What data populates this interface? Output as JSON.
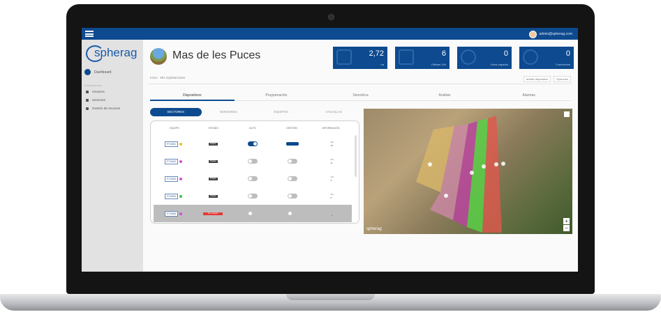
{
  "app": {
    "brand": "spherag",
    "user_email": "admin@spherag.com",
    "accent": "#0d4a8f"
  },
  "sidebar": {
    "home_label": "Dashboard",
    "group_label": "Explotaciones",
    "items": [
      {
        "label": "Usuarios",
        "icon": "user-icon"
      },
      {
        "label": "Sensores",
        "icon": "sensor-icon"
      },
      {
        "label": "Gestión de recursos",
        "icon": "gear-icon"
      }
    ]
  },
  "page": {
    "title": "Mas de les Puces",
    "breadcrumb": [
      "Inicio",
      "Mis explotaciones"
    ],
    "actions": [
      "Añadir dispositivo",
      "Opciones"
    ]
  },
  "stats": [
    {
      "value": "2,72",
      "label": "ha",
      "icon": "area-icon"
    },
    {
      "value": "6",
      "label": "Últimas 24h",
      "icon": "book-icon"
    },
    {
      "value": "0",
      "label": "Litros regados",
      "icon": "drop-icon"
    },
    {
      "value": "0",
      "label": "Conexiones",
      "icon": "signal-icon"
    }
  ],
  "tabs": [
    {
      "label": "Dispositivos",
      "active": true
    },
    {
      "label": "Programación",
      "active": false
    },
    {
      "label": "Sensórica",
      "active": false
    },
    {
      "label": "Análisis",
      "active": false
    },
    {
      "label": "Alarmas",
      "active": false
    }
  ],
  "subtabs": [
    {
      "label": "SECTORES",
      "active": true
    },
    {
      "label": "SENSORES",
      "active": false
    },
    {
      "label": "EQUIPOS",
      "active": false
    },
    {
      "label": "VÁLVULAS",
      "active": false
    }
  ],
  "table": {
    "columns": [
      "EQUIPO",
      "ESTADO",
      "AUTO",
      "GESTIÓN",
      "INFORMACIÓN"
    ],
    "rows": [
      {
        "device": "FT-0001",
        "dot": "#e6c21a",
        "state": "Parado",
        "auto": true,
        "manage": true,
        "info": [
          "4.6",
          "18"
        ],
        "selected": false
      },
      {
        "device": "FT-0002",
        "dot": "#d64fd6",
        "state": "Parado",
        "auto": false,
        "manage": false,
        "info": [
          "4.6",
          "11"
        ],
        "selected": false
      },
      {
        "device": "FT-0003",
        "dot": "#d64fd6",
        "state": "Parado",
        "auto": false,
        "manage": false,
        "info": [
          "4.6",
          "9"
        ],
        "selected": false
      },
      {
        "device": "FT-0004",
        "dot": "#3cc73c",
        "state": "Parado",
        "auto": false,
        "manage": false,
        "info": [
          "4.6",
          "8"
        ],
        "selected": false
      },
      {
        "device": "FT-0005",
        "dot": "#d64fd6",
        "state": "Sin conexión",
        "auto": false,
        "manage": false,
        "info": [
          "–",
          "1"
        ],
        "selected": true
      }
    ]
  },
  "map": {
    "logo": "spherag",
    "zoom_in": "+",
    "zoom_out": "−"
  }
}
